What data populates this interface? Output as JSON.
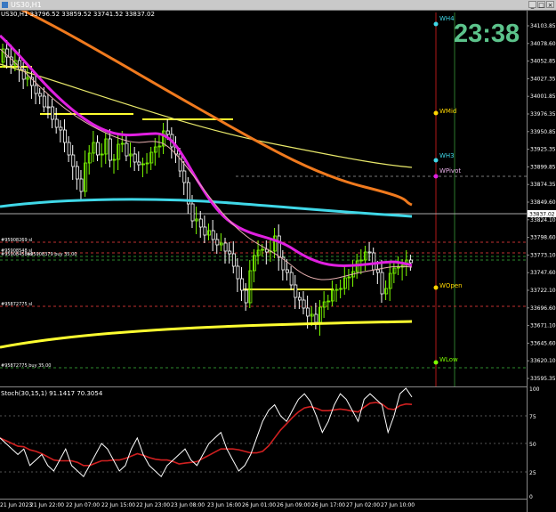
{
  "window": {
    "title": "US30,H1",
    "min_label": "_",
    "max_label": "□",
    "close_label": "×"
  },
  "chart": {
    "info_line": "US30,H1  33796.52 33859.52 33741.52 33837.02",
    "clock": "23:38",
    "current_price": "33837.02",
    "price_labels": [
      "34103.85",
      "34078.60",
      "34052.85",
      "34027.35",
      "34001.85",
      "33976.35",
      "33950.85",
      "33925.35",
      "33899.85",
      "33874.35",
      "33849.60",
      "33824.10",
      "33798.60",
      "33773.10",
      "33747.60",
      "33722.10",
      "33696.60",
      "33671.10",
      "33645.60",
      "33620.10",
      "33595.35"
    ],
    "level_labels": [
      "WH4",
      "WMid",
      "WH3",
      "WPivot",
      "WOpen",
      "WLow"
    ],
    "order_labels": [
      "#95908269 sl",
      "#95908548 sl",
      "#95908458 sl",
      "#95908379 buy 35.00",
      "#95872775 sl",
      "#95872775 buy 35.00"
    ],
    "time_labels": [
      "21 Jun 2023",
      "21 Jun 22:00",
      "22 Jun 07:00",
      "22 Jun 15:00",
      "22 Jun 23:00",
      "23 Jun 08:00",
      "23 Jun 16:00",
      "26 Jun 01:00",
      "26 Jun 09:00",
      "26 Jun 17:00",
      "27 Jun 02:00",
      "27 Jun 10:00"
    ],
    "colors": {
      "bull_candle": "#7CFC00",
      "bear_candle": "#ffffff",
      "ma_magenta": "#e020e0",
      "ma_orange": "#f07a1e",
      "ma_yellow": "#e8e86a",
      "ma_cyan": "#40d8e8",
      "ma_long_yellow": "#ffff30"
    }
  },
  "indicator": {
    "label": "Stoch(30,15,1) 91.1417 70.3054",
    "levels": [
      "100",
      "75",
      "50",
      "25",
      "0"
    ]
  }
}
